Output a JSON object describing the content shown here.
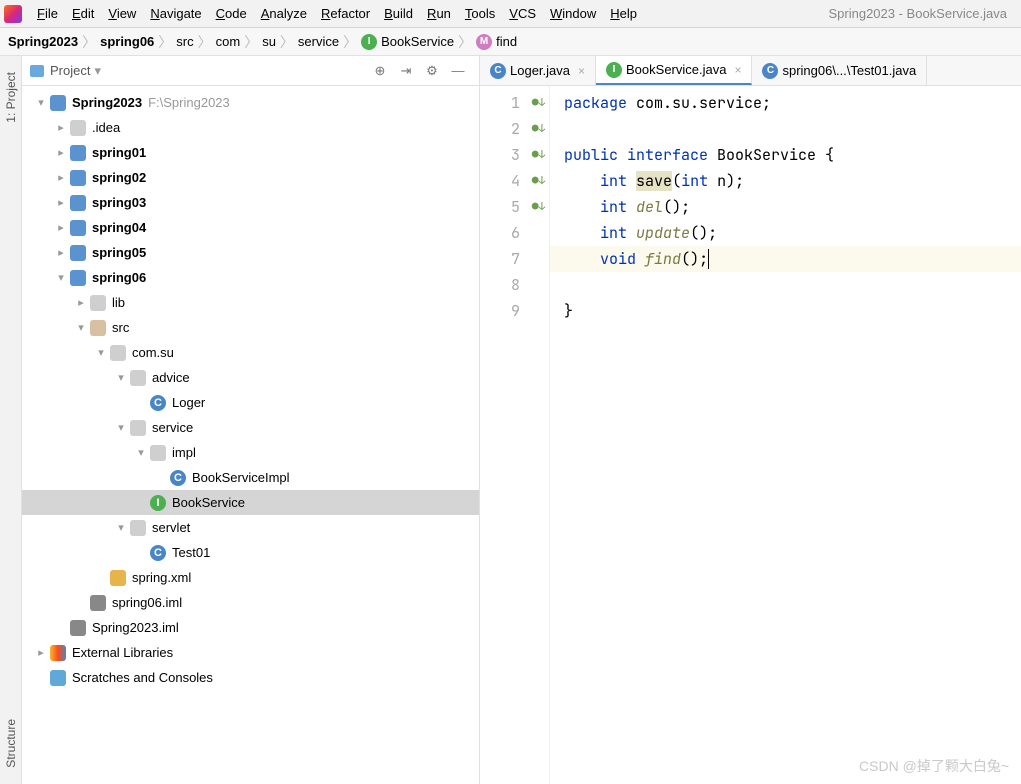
{
  "window": {
    "title": "Spring2023 - BookService.java"
  },
  "menu": [
    "File",
    "Edit",
    "View",
    "Navigate",
    "Code",
    "Analyze",
    "Refactor",
    "Build",
    "Run",
    "Tools",
    "VCS",
    "Window",
    "Help"
  ],
  "breadcrumbs": [
    {
      "label": "Spring2023",
      "bold": true
    },
    {
      "label": "spring06",
      "bold": true
    },
    {
      "label": "src"
    },
    {
      "label": "com"
    },
    {
      "label": "su"
    },
    {
      "label": "service"
    },
    {
      "label": "BookService",
      "icon": "i"
    },
    {
      "label": "find",
      "icon": "m"
    }
  ],
  "sidebar": {
    "title": "Project",
    "tree": [
      {
        "ind": 12,
        "tw": "▾",
        "ico": "module",
        "label": "Spring2023",
        "bold": true,
        "muted": "F:\\Spring2023"
      },
      {
        "ind": 32,
        "tw": "▸",
        "ico": "folder",
        "label": ".idea"
      },
      {
        "ind": 32,
        "tw": "▸",
        "ico": "module",
        "label": "spring01",
        "bold": true
      },
      {
        "ind": 32,
        "tw": "▸",
        "ico": "module",
        "label": "spring02",
        "bold": true
      },
      {
        "ind": 32,
        "tw": "▸",
        "ico": "module",
        "label": "spring03",
        "bold": true
      },
      {
        "ind": 32,
        "tw": "▸",
        "ico": "module",
        "label": "spring04",
        "bold": true
      },
      {
        "ind": 32,
        "tw": "▸",
        "ico": "module",
        "label": "spring05",
        "bold": true
      },
      {
        "ind": 32,
        "tw": "▾",
        "ico": "module",
        "label": "spring06",
        "bold": true
      },
      {
        "ind": 52,
        "tw": "▸",
        "ico": "folder",
        "label": "lib"
      },
      {
        "ind": 52,
        "tw": "▾",
        "ico": "folder open",
        "label": "src"
      },
      {
        "ind": 72,
        "tw": "▾",
        "ico": "pkg",
        "label": "com.su"
      },
      {
        "ind": 92,
        "tw": "▾",
        "ico": "pkg",
        "label": "advice"
      },
      {
        "ind": 112,
        "tw": "",
        "ico": "class-c",
        "icoText": "C",
        "label": "Loger"
      },
      {
        "ind": 92,
        "tw": "▾",
        "ico": "pkg",
        "label": "service"
      },
      {
        "ind": 112,
        "tw": "▾",
        "ico": "pkg",
        "label": "impl"
      },
      {
        "ind": 132,
        "tw": "",
        "ico": "class-c",
        "icoText": "C",
        "label": "BookServiceImpl"
      },
      {
        "ind": 112,
        "tw": "",
        "ico": "class-i",
        "icoText": "I",
        "label": "BookService",
        "selected": true
      },
      {
        "ind": 92,
        "tw": "▾",
        "ico": "pkg",
        "label": "servlet"
      },
      {
        "ind": 112,
        "tw": "",
        "ico": "class-ct",
        "icoText": "C",
        "label": "Test01"
      },
      {
        "ind": 72,
        "tw": "",
        "ico": "xml",
        "label": "spring.xml"
      },
      {
        "ind": 52,
        "tw": "",
        "ico": "iml",
        "label": "spring06.iml"
      },
      {
        "ind": 32,
        "tw": "",
        "ico": "iml",
        "label": "Spring2023.iml"
      },
      {
        "ind": 12,
        "tw": "▸",
        "ico": "lib",
        "label": "External Libraries"
      },
      {
        "ind": 12,
        "tw": "",
        "ico": "scratch",
        "label": "Scratches and Consoles"
      }
    ]
  },
  "tabs": [
    {
      "label": "Loger.java",
      "icon": "c",
      "active": false
    },
    {
      "label": "BookService.java",
      "icon": "i",
      "active": true
    },
    {
      "label": "spring06\\...\\Test01.java",
      "icon": "c",
      "active": false,
      "noclose": true
    }
  ],
  "code": {
    "lines": [
      {
        "n": 1,
        "marker": "",
        "tokens": [
          [
            "kw",
            "package"
          ],
          [
            "",
            " com.su.service;"
          ]
        ]
      },
      {
        "n": 2,
        "marker": "",
        "tokens": [
          [
            "",
            ""
          ]
        ]
      },
      {
        "n": 3,
        "marker": "●↓",
        "tokens": [
          [
            "kw",
            "public"
          ],
          [
            "",
            " "
          ],
          [
            "kw",
            "interface"
          ],
          [
            "",
            " BookService {"
          ]
        ]
      },
      {
        "n": 4,
        "marker": "●↓",
        "tokens": [
          [
            "",
            "    "
          ],
          [
            "kw",
            "int"
          ],
          [
            "",
            " "
          ],
          [
            "hl",
            "save"
          ],
          [
            "",
            "("
          ],
          [
            "kw",
            "int"
          ],
          [
            "",
            " n);"
          ]
        ]
      },
      {
        "n": 5,
        "marker": "●↓",
        "tokens": [
          [
            "",
            "    "
          ],
          [
            "kw",
            "int"
          ],
          [
            "",
            " "
          ],
          [
            "fn",
            "del"
          ],
          [
            "",
            "();"
          ]
        ]
      },
      {
        "n": 6,
        "marker": "●↓",
        "tokens": [
          [
            "",
            "    "
          ],
          [
            "kw",
            "int"
          ],
          [
            "",
            " "
          ],
          [
            "fn",
            "update"
          ],
          [
            "",
            "();"
          ]
        ]
      },
      {
        "n": 7,
        "marker": "●↓",
        "cursor": true,
        "tokens": [
          [
            "",
            "    "
          ],
          [
            "kw",
            "void"
          ],
          [
            "",
            " "
          ],
          [
            "fn",
            "find"
          ],
          [
            "",
            "();"
          ]
        ]
      },
      {
        "n": 8,
        "marker": "",
        "tokens": [
          [
            "",
            "}"
          ]
        ]
      },
      {
        "n": 9,
        "marker": "",
        "tokens": [
          [
            "",
            ""
          ]
        ]
      }
    ]
  },
  "gutterTabs": [
    "1: Project",
    "Structure"
  ],
  "watermark": "CSDN @掉了颗大白兔~"
}
